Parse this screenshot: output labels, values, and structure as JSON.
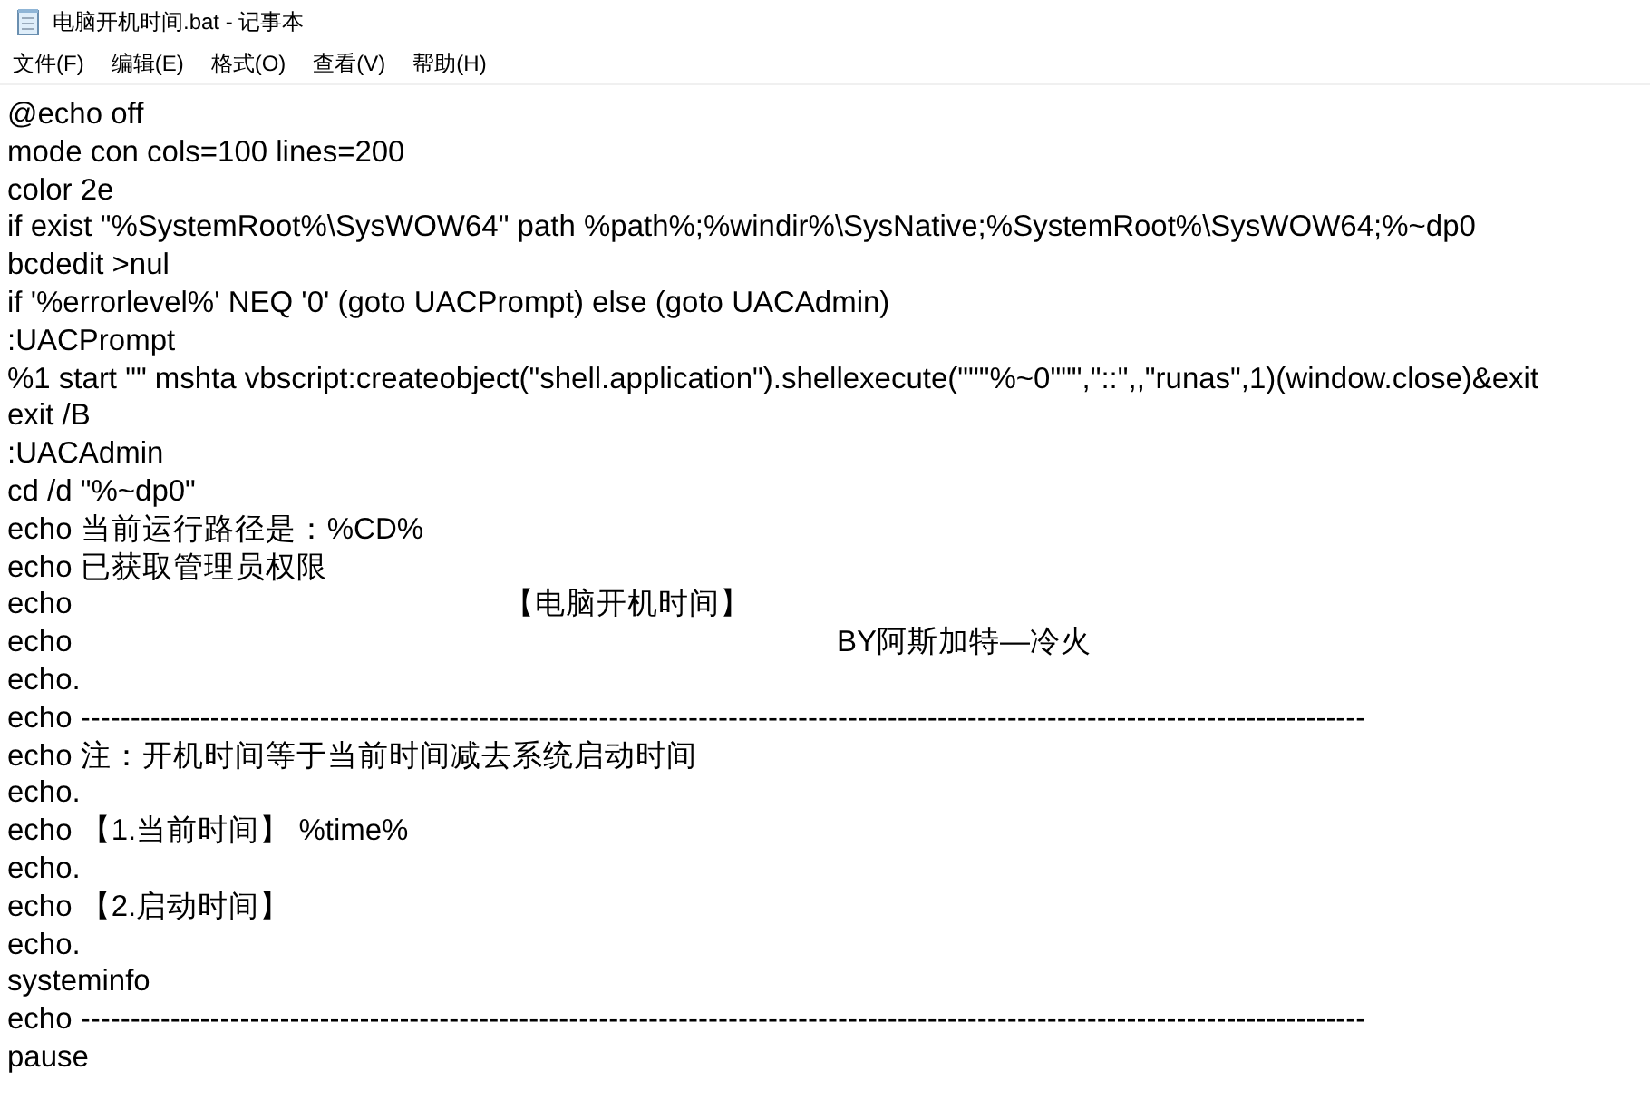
{
  "window": {
    "title": "电脑开机时间.bat - 记事本"
  },
  "menu": [
    {
      "label": "文件(F)"
    },
    {
      "label": "编辑(E)"
    },
    {
      "label": "格式(O)"
    },
    {
      "label": "查看(V)"
    },
    {
      "label": "帮助(H)"
    }
  ],
  "lines": [
    "@echo off",
    "mode con cols=100 lines=200",
    "color 2e",
    "if exist \"%SystemRoot%\\SysWOW64\" path %path%;%windir%\\SysNative;%SystemRoot%\\SysWOW64;%~dp0",
    "bcdedit >nul",
    "if '%errorlevel%' NEQ '0' (goto UACPrompt) else (goto UACAdmin)",
    ":UACPrompt",
    "%1 start \"\" mshta vbscript:createobject(\"shell.application\").shellexecute(\"\"\"%~0\"\"\",\"::\",,\"runas\",1)(window.close)&exit",
    "exit /B",
    ":UACAdmin",
    "cd /d \"%~dp0\"",
    "echo 当前运行路径是：%CD%",
    "echo 已获取管理员权限",
    "echo                                                    【电脑开机时间】",
    "echo                                                                                            BY阿斯加特—冷火",
    "echo.",
    "echo ---------------------------------------------------------------------------------------------------------------------------------",
    "echo 注：开机时间等于当前时间减去系统启动时间",
    "echo.",
    "echo 【1.当前时间】 %time%",
    "echo.",
    "echo 【2.启动时间】",
    "echo.",
    "systeminfo",
    "echo ---------------------------------------------------------------------------------------------------------------------------------",
    "pause"
  ]
}
